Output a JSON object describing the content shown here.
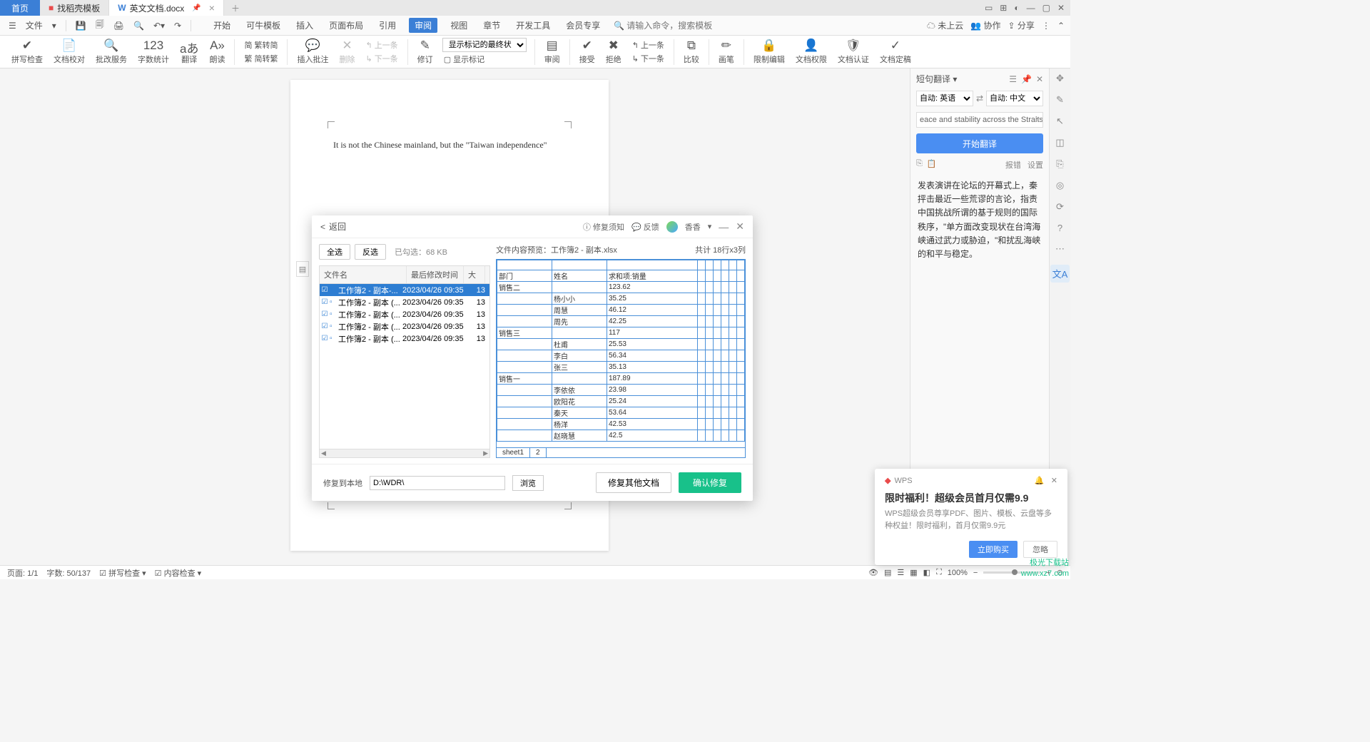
{
  "tabs": {
    "home": "首页",
    "template": "找稻壳模板",
    "doc": "英文文档.docx"
  },
  "qat": {
    "file": "文件"
  },
  "menu": [
    "开始",
    "可牛模板",
    "插入",
    "页面布局",
    "引用",
    "审阅",
    "视图",
    "章节",
    "开发工具",
    "会员专享"
  ],
  "menu_active_index": 5,
  "search_placeholder": "请输入命令，搜索模板",
  "cloud_right": {
    "cloud": "未上云",
    "collab": "协作",
    "share": "分享"
  },
  "ribbon": {
    "spell": "拼写检查",
    "doccheck": "文档校对",
    "batch": "批改服务",
    "wordcount": "字数统计",
    "translate": "翻译",
    "read": "朗读",
    "fan2jian": "繁转简",
    "jian2fan": "简转繁",
    "insert_comment": "插入批注",
    "delete": "删除",
    "prev": "上一条",
    "next": "下一条",
    "revise": "修订",
    "track_select": "显示标记的最终状态",
    "show_mark": "显示标记",
    "review": "审阅",
    "accept": "接受",
    "reject": "拒绝",
    "prev2": "上一条",
    "next2": "下一条",
    "compare": "比较",
    "pen": "画笔",
    "restrict": "限制编辑",
    "doc_perm": "文档权限",
    "doc_auth": "文档认证",
    "doc_finalize": "文档定稿"
  },
  "page_text": "It is not the Chinese mainland, but the \"Taiwan independence\"",
  "dialog": {
    "back": "返回",
    "repair_notice": "修复须知",
    "feedback": "反馈",
    "user": "香香",
    "select_all": "全选",
    "invert_sel": "反选",
    "selected": "已勾选：68 KB",
    "cols": {
      "name": "文件名",
      "date": "最后修改时间",
      "size": "大"
    },
    "rows": [
      {
        "name": "工作簿2 - 副本-...",
        "date": "2023/04/26 09:35",
        "size": "13",
        "sel": true
      },
      {
        "name": "工作簿2 - 副本 (...",
        "date": "2023/04/26 09:35",
        "size": "13",
        "sel": true
      },
      {
        "name": "工作簿2 - 副本 (...",
        "date": "2023/04/26 09:35",
        "size": "13",
        "sel": true
      },
      {
        "name": "工作簿2 - 副本 (...",
        "date": "2023/04/26 09:35",
        "size": "13",
        "sel": true
      },
      {
        "name": "工作簿2 - 副本 (...",
        "date": "2023/04/26 09:35",
        "size": "13",
        "sel": true
      }
    ],
    "preview_label": "文件内容预览：",
    "preview_file": "工作簿2 - 副本.xlsx",
    "total": "共计 18行x3列",
    "table": [
      [
        "",
        "",
        "",
        ""
      ],
      [
        "部门",
        "姓名",
        "求和项:销量",
        ""
      ],
      [
        "销售二",
        "",
        "123.62",
        ""
      ],
      [
        "",
        "杨小小",
        "35.25",
        ""
      ],
      [
        "",
        "周慧",
        "46.12",
        ""
      ],
      [
        "",
        "周先",
        "42.25",
        ""
      ],
      [
        "销售三",
        "",
        "117",
        ""
      ],
      [
        "",
        "杜甫",
        "25.53",
        ""
      ],
      [
        "",
        "李白",
        "56.34",
        ""
      ],
      [
        "",
        "张三",
        "35.13",
        ""
      ],
      [
        "销售一",
        "",
        "187.89",
        ""
      ],
      [
        "",
        "李依依",
        "23.98",
        ""
      ],
      [
        "",
        "欧阳花",
        "25.24",
        ""
      ],
      [
        "",
        "秦天",
        "53.64",
        ""
      ],
      [
        "",
        "杨洋",
        "42.53",
        ""
      ],
      [
        "",
        "赵晓慧",
        "42.5",
        ""
      ]
    ],
    "sheets": [
      "sheet1",
      "2"
    ],
    "repair_to": "修复到本地",
    "repair_path": "D:\\WDR\\",
    "browse": "浏览",
    "repair_other": "修复其他文档",
    "confirm": "确认修复"
  },
  "translate": {
    "title": "短句翻译",
    "from": "自动: 英语",
    "to": "自动: 中文",
    "input": "eace and stability across the Straits.",
    "btn": "开始翻译",
    "report": "报错",
    "settings": "设置",
    "result": "发表演讲在论坛的开幕式上，秦抨击最近一些荒谬的言论，指责中国挑战所谓的基于规则的国际秩序，\"单方面改变现状在台湾海峡通过武力或胁迫，\"和扰乱海峡的和平与稳定。"
  },
  "status": {
    "page": "页面: 1/1",
    "words": "字数: 50/137",
    "spell": "拼写检查",
    "content": "内容检查",
    "zoom": "100%"
  },
  "promo": {
    "brand": "WPS",
    "title": "限时福利！超级会员首月仅需9.9",
    "desc": "WPS超级会员尊享PDF、图片、模板、云盘等多种权益！限时福利，首月仅需9.9元",
    "buy": "立即购买",
    "skip": "忽略"
  },
  "watermark": {
    "l1": "极光下载站",
    "l2": "www.xz7.com"
  }
}
